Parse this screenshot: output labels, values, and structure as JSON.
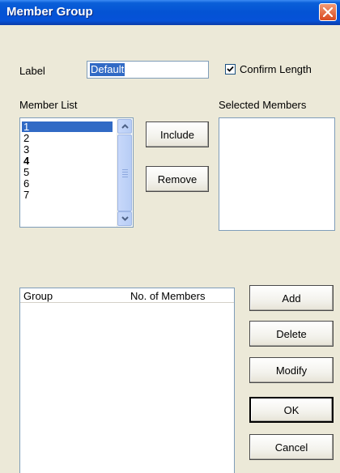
{
  "window": {
    "title": "Member Group"
  },
  "label": {
    "caption": "Label",
    "value": "Default"
  },
  "confirm_length": {
    "label": "Confirm Length",
    "checked": true
  },
  "member_list": {
    "caption": "Member List",
    "items": [
      "1",
      "2",
      "3",
      "4",
      "5",
      "6",
      "7"
    ],
    "selected_index": 0,
    "bold_index": 3
  },
  "selected_members": {
    "caption": "Selected Members"
  },
  "buttons": {
    "include": "Include",
    "remove": "Remove",
    "add": "Add",
    "delete": "Delete",
    "modify": "Modify",
    "ok": "OK",
    "cancel": "Cancel"
  },
  "group_table": {
    "columns": [
      "Group",
      "No. of Members"
    ]
  },
  "colors": {
    "titlebar": "#0453d4",
    "selection": "#316ac5",
    "dialog_bg": "#ece9d8"
  },
  "icons": {
    "close": "close-icon",
    "scroll_up": "chevron-up-icon",
    "scroll_down": "chevron-down-icon",
    "check": "check-icon"
  }
}
